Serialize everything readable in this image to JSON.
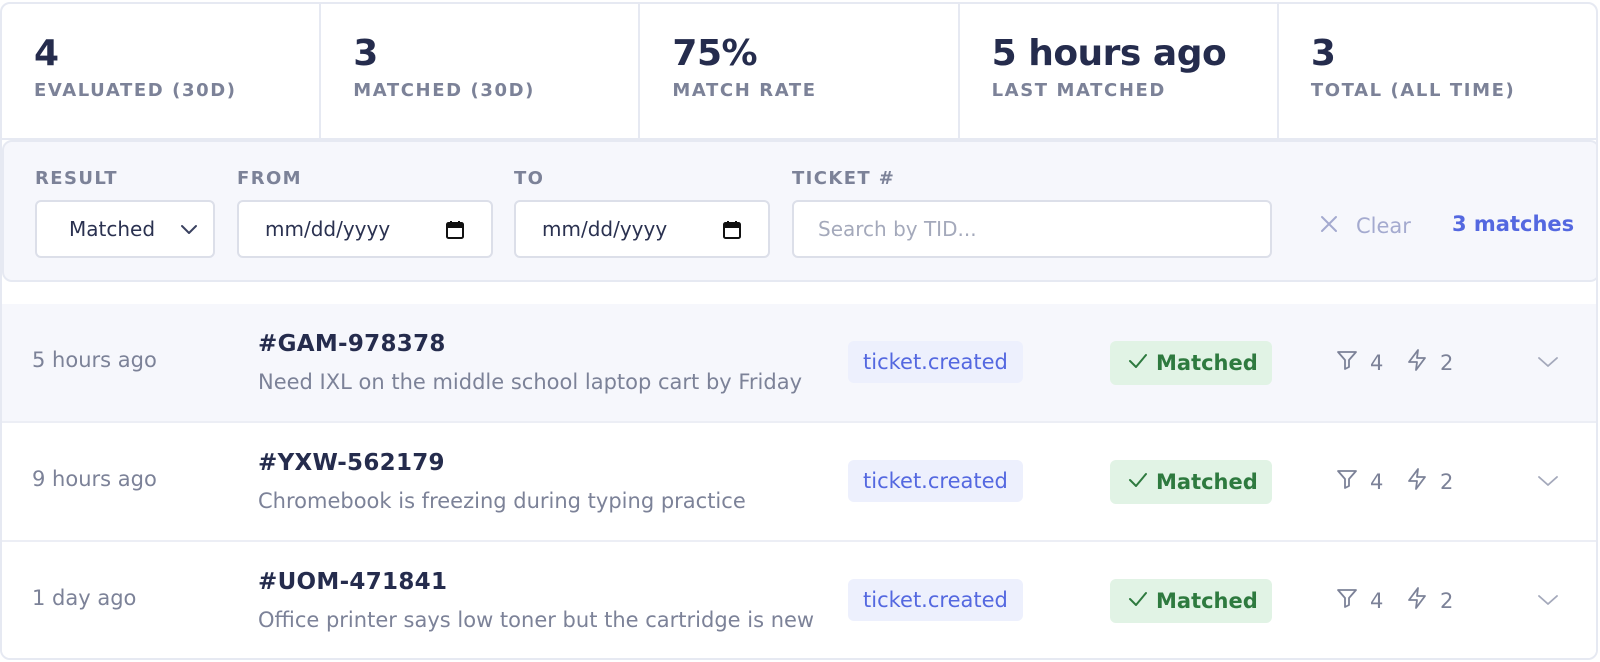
{
  "stats": [
    {
      "value": "4",
      "label": "EVALUATED (30D)"
    },
    {
      "value": "3",
      "label": "MATCHED (30D)"
    },
    {
      "value": "75%",
      "label": "MATCH RATE"
    },
    {
      "value": "5 hours ago",
      "label": "LAST MATCHED"
    },
    {
      "value": "3",
      "label": "TOTAL (ALL TIME)"
    }
  ],
  "filters": {
    "result_label": "RESULT",
    "result_value": "Matched",
    "from_label": "FROM",
    "from_value": "mm/dd/yyyy",
    "to_label": "TO",
    "to_value": "mm/dd/yyyy",
    "ticket_label": "TICKET #",
    "ticket_placeholder": "Search by TID...",
    "clear_label": "Clear",
    "matches_text": "3 matches"
  },
  "rows": [
    {
      "time": "5 hours ago",
      "ticket": "#GAM-978378",
      "description": "Need IXL on the middle school laptop cart by Friday",
      "event": "ticket.created",
      "status": "Matched",
      "conditions": "4",
      "actions": "2"
    },
    {
      "time": "9 hours ago",
      "ticket": "#YXW-562179",
      "description": "Chromebook is freezing during typing practice",
      "event": "ticket.created",
      "status": "Matched",
      "conditions": "4",
      "actions": "2"
    },
    {
      "time": "1 day ago",
      "ticket": "#UOM-471841",
      "description": "Office printer says low toner but the cartridge is new",
      "event": "ticket.created",
      "status": "Matched",
      "conditions": "4",
      "actions": "2"
    }
  ],
  "colors": {
    "accent": "#5468e0",
    "success_bg": "#e1f3e5",
    "success_text": "#2e7a3f",
    "muted": "#7c8298"
  },
  "icons": {
    "condition": "filter-icon",
    "action": "lightning-icon",
    "expand": "chevron-down-icon",
    "clear": "close-icon",
    "status": "check-icon"
  }
}
